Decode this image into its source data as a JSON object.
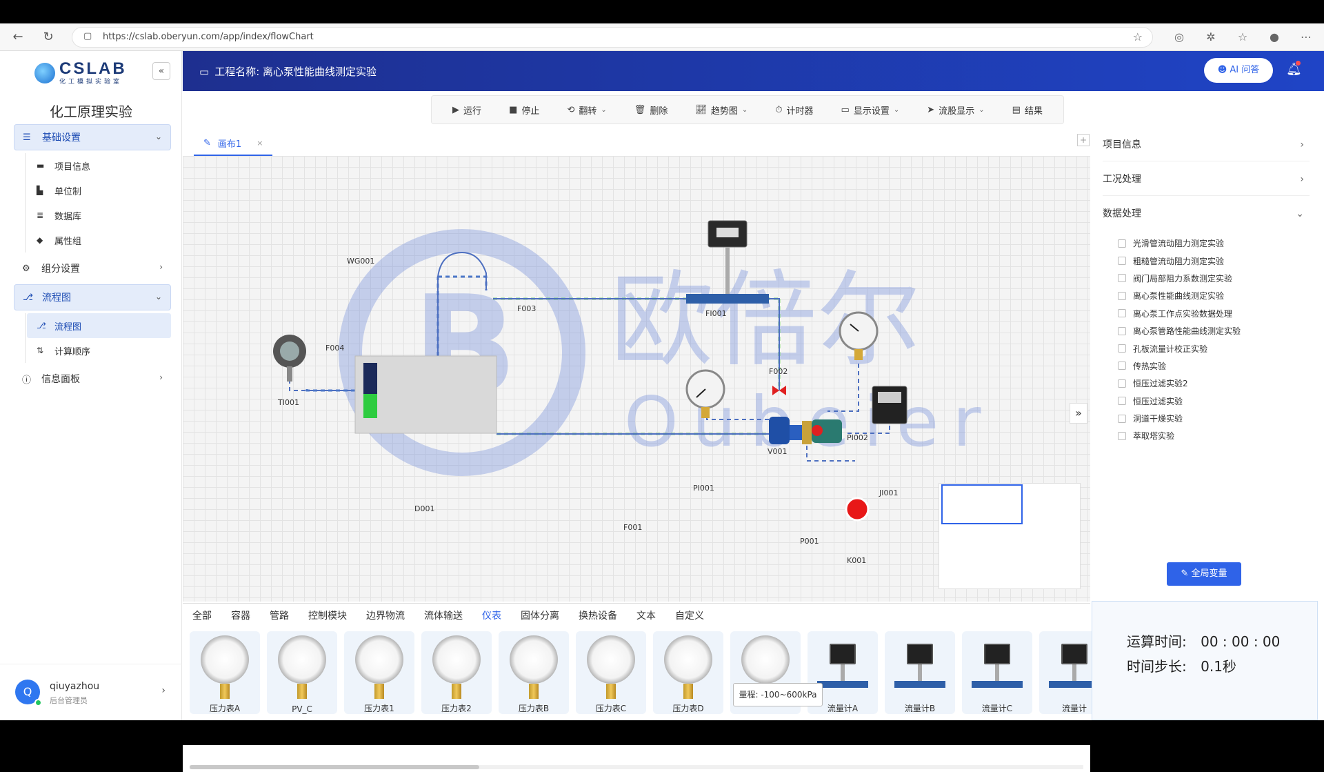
{
  "browser": {
    "url": "https://cslab.oberyun.com/app/index/flowChart"
  },
  "sidebar": {
    "logo_text": "CSLAB",
    "logo_sub": "化工模拟实验室",
    "title": "化工原理实验",
    "groups": [
      {
        "label": "基础设置",
        "items": [
          "项目信息",
          "单位制",
          "数据库",
          "属性组"
        ]
      },
      {
        "label": "组分设置"
      },
      {
        "label": "流程图",
        "items": [
          "流程图",
          "计算顺序"
        ]
      },
      {
        "label": "信息面板"
      }
    ],
    "user": {
      "avatar": "Q",
      "name": "qiuyazhou",
      "role": "后台管理员"
    }
  },
  "header": {
    "title": "工程名称: 离心泵性能曲线测定实验",
    "ai_button": "AI 问答"
  },
  "toolbar": {
    "run": "运行",
    "stop": "停止",
    "flip": "翻转",
    "delete": "删除",
    "trend": "趋势图",
    "timer": "计时器",
    "display": "显示设置",
    "stream": "流股显示",
    "result": "结果"
  },
  "canvas": {
    "tab": "画布1",
    "labels": {
      "WG001": "WG001",
      "F003": "F003",
      "FI001": "FI001",
      "F004": "F004",
      "F002": "F002",
      "TI001": "TI001",
      "D001": "D001",
      "F001": "F001",
      "V001": "V001",
      "PI001": "PI001",
      "PI002": "PI002",
      "JI001": "JI001",
      "P001": "P001",
      "K001": "K001"
    },
    "watermark_cn": "欧倍尔",
    "watermark_en": "Oubeier"
  },
  "palette": {
    "categories": [
      "全部",
      "容器",
      "管路",
      "控制模块",
      "边界物流",
      "流体输送",
      "仪表",
      "固体分离",
      "换热设备",
      "文本",
      "自定义"
    ],
    "active_category": "仪表",
    "items": [
      {
        "label": "压力表A",
        "kind": "gauge"
      },
      {
        "label": "PV_C",
        "kind": "gauge"
      },
      {
        "label": "压力表1",
        "kind": "gauge"
      },
      {
        "label": "压力表2",
        "kind": "gauge"
      },
      {
        "label": "压力表B",
        "kind": "gauge"
      },
      {
        "label": "压力表C",
        "kind": "gauge"
      },
      {
        "label": "压力表D",
        "kind": "gauge"
      },
      {
        "label": "",
        "kind": "gauge"
      },
      {
        "label": "流量计A",
        "kind": "meter"
      },
      {
        "label": "流量计B",
        "kind": "meter"
      },
      {
        "label": "流量计C",
        "kind": "meter"
      },
      {
        "label": "流量计",
        "kind": "meter"
      }
    ],
    "tooltip": "量程: -100~600kPa"
  },
  "right_panel": {
    "sections": [
      "项目信息",
      "工况处理",
      "数据处理"
    ],
    "experiments": [
      "光滑管流动阻力测定实验",
      "粗糙管流动阻力测定实验",
      "阀门局部阻力系数测定实验",
      "离心泵性能曲线测定实验",
      "离心泵工作点实验数据处理",
      "离心泵管路性能曲线测定实验",
      "孔板流量计校正实验",
      "传热实验",
      "恒压过滤实验2",
      "恒压过滤实验",
      "洞道干燥实验",
      "萃取塔实验"
    ],
    "global_button": "全局变量"
  },
  "timer": {
    "run_label": "运算时间:",
    "run_value": "00 : 00 : 00",
    "step_label": "时间步长:",
    "step_value": "0.1秒"
  }
}
